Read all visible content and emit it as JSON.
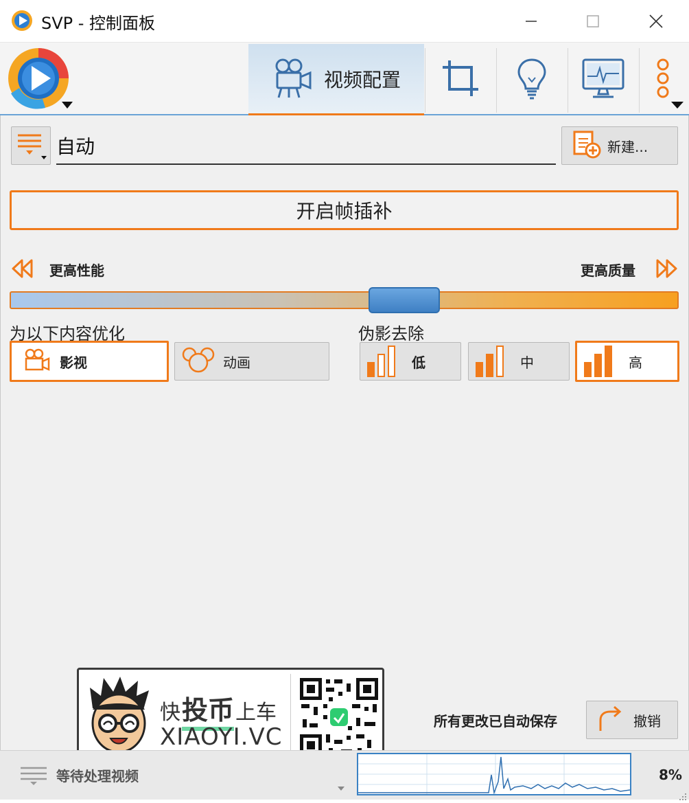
{
  "window": {
    "title": "SVP - 控制面板"
  },
  "tabs": [
    {
      "label": "视频配置",
      "icon": "video-camera-icon",
      "active": true
    },
    {
      "label": "",
      "icon": "crop-icon"
    },
    {
      "label": "",
      "icon": "lightbulb-icon"
    },
    {
      "label": "",
      "icon": "monitor-icon"
    },
    {
      "label": "",
      "icon": "more-dots-icon"
    }
  ],
  "profile": {
    "value": "自动",
    "new_label": "新建..."
  },
  "main": {
    "enable_label": "开启帧插补",
    "slider": {
      "left_label": "更高性能",
      "right_label": "更高质量",
      "position": 0.59
    },
    "optimize": {
      "heading": "为以下内容优化",
      "options": [
        "影视",
        "动画"
      ],
      "selected": "影视"
    },
    "artifact": {
      "heading": "伪影去除",
      "options": [
        "低",
        "中",
        "高"
      ],
      "selected": "高"
    }
  },
  "footer": {
    "autosave_text": "所有更改已自动保存",
    "undo_label": "撤销"
  },
  "status": {
    "text": "等待处理视频",
    "cpu_percent": "8%"
  },
  "watermark": {
    "text1": "快",
    "text2": "投币",
    "text3": "上车",
    "url": "XIAOYI.VC"
  },
  "colors": {
    "accent": "#f07a1a",
    "blue": "#6aa3d6",
    "slider_thumb": "#4a8ac8"
  }
}
